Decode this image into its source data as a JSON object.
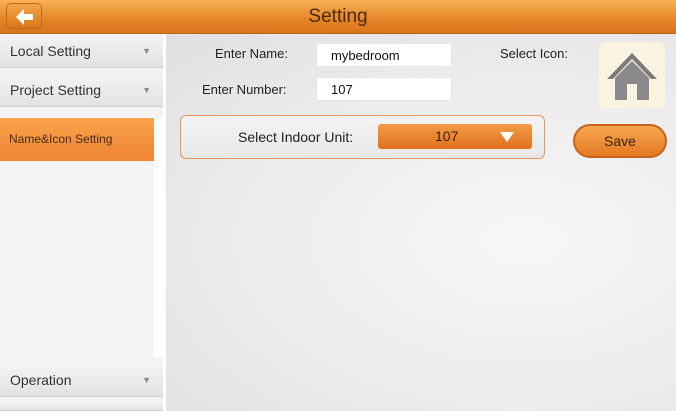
{
  "header": {
    "title": "Setting"
  },
  "sidebar": {
    "items": [
      {
        "label": "Local Setting"
      },
      {
        "label": "Project Setting"
      },
      {
        "label": "Operation"
      }
    ],
    "sub_item": "Name&Icon Setting"
  },
  "form": {
    "name_label": "Enter Name:",
    "name_value": "mybedroom",
    "number_label": "Enter Number:",
    "number_value": "107",
    "icon_label": "Select Icon:",
    "icon_name": "house-icon",
    "unit_label": "Select Indoor Unit:",
    "unit_value": "107",
    "save_label": "Save"
  },
  "colors": {
    "accent": "#ef8532",
    "title_bar": "#e8862a"
  }
}
